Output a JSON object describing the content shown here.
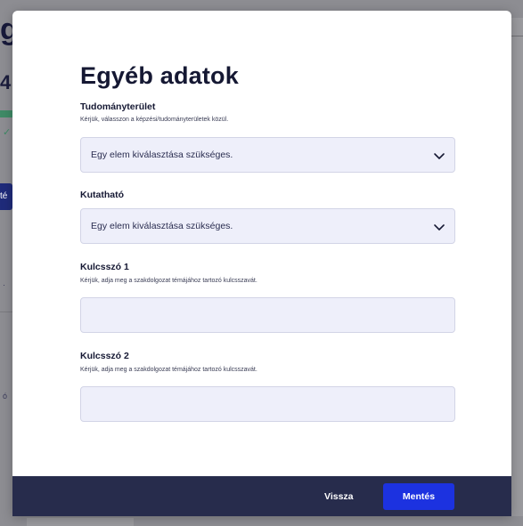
{
  "background": {
    "title_fragment": "g",
    "number_fragment": "4",
    "button_fragment": "té",
    "small_fragment": "ó"
  },
  "modal": {
    "title": "Egyéb adatok",
    "fields": [
      {
        "label": "Tudományterület",
        "help": "Kérjük, válasszon a képzési/tudományterületek közül.",
        "type": "select",
        "value": "Egy elem kiválasztása szükséges."
      },
      {
        "label": "Kutatható",
        "help": "",
        "type": "select",
        "value": "Egy elem kiválasztása szükséges."
      },
      {
        "label": "Kulcsszó 1",
        "help": "Kérjük, adja meg a szakdolgozat témájához tartozó kulcsszavát.",
        "type": "text",
        "value": "",
        "placeholder": ""
      },
      {
        "label": "Kulcsszó 2",
        "help": "Kérjük, adja meg a szakdolgozat témájához tartozó kulcsszavát.",
        "type": "text",
        "value": "",
        "placeholder": ""
      }
    ]
  },
  "footer": {
    "back_label": "Vissza",
    "save_label": "Mentés"
  },
  "icons": {
    "select_chevron": "chevron-down-icon"
  },
  "colors": {
    "primary_button": "#1c32e0",
    "footer_bg": "#272c4c",
    "field_bg": "#eeeffa",
    "title_text": "#151833"
  }
}
